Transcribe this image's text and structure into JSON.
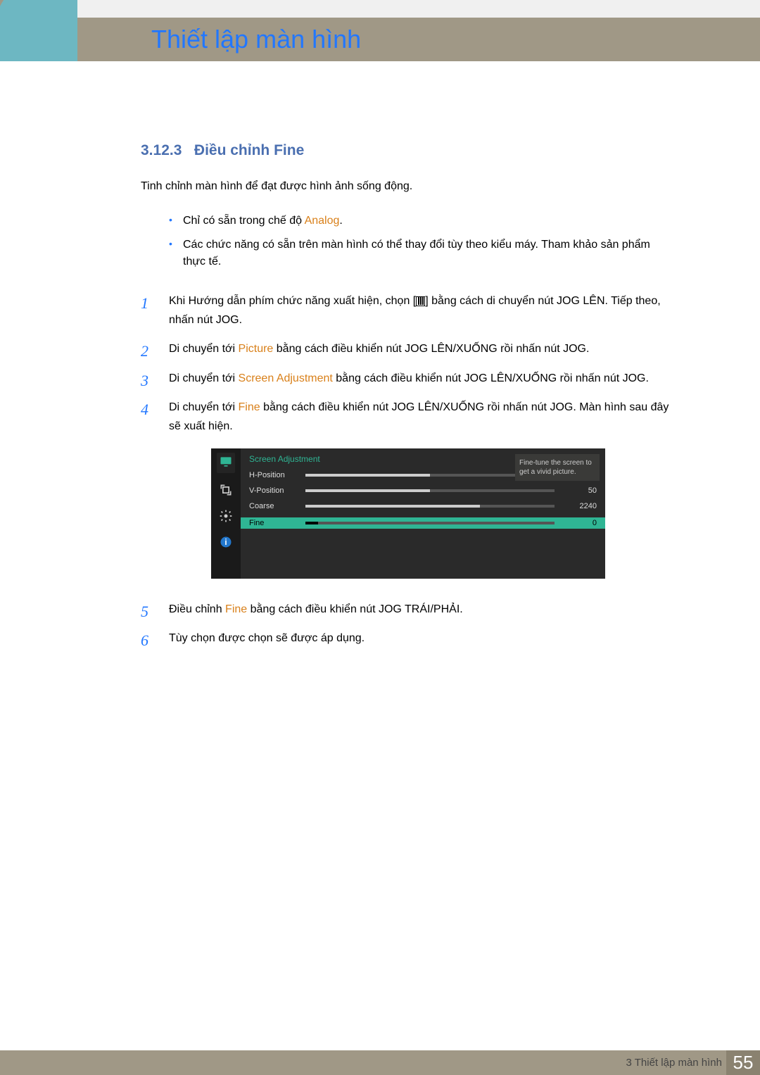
{
  "chapter_title": "Thiết lập màn hình",
  "section": {
    "number": "3.12.3",
    "title": "Điều chỉnh Fine"
  },
  "intro": "Tinh chỉnh màn hình để đạt được hình ảnh sống động.",
  "notes": [
    {
      "pre": "Chỉ có sẵn trong chế độ ",
      "accent": "Analog",
      "post": "."
    },
    {
      "pre": "Các chức năng có sẵn trên màn hình có thể thay đổi tùy theo kiểu máy. Tham khảo sản phẩm thực tế.",
      "accent": "",
      "post": ""
    }
  ],
  "steps": [
    {
      "pre": "Khi Hướng dẫn phím chức năng xuất hiện, chọn [",
      "accent": "",
      "icon": true,
      "post": "] bằng cách di chuyển nút JOG LÊN. Tiếp theo, nhấn nút JOG."
    },
    {
      "pre": "Di chuyển tới ",
      "accent": "Picture",
      "post": " bằng cách điều khiển nút JOG LÊN/XUỐNG rồi nhấn nút JOG."
    },
    {
      "pre": "Di chuyển tới ",
      "accent": "Screen Adjustment",
      "post": " bằng cách điều khiển nút JOG LÊN/XUỐNG rồi nhấn nút JOG."
    },
    {
      "pre": "Di chuyển tới ",
      "accent": "Fine",
      "post": " bằng cách điều khiển nút JOG LÊN/XUỐNG rồi nhấn nút JOG. Màn hình sau đây sẽ xuất hiện."
    },
    {
      "pre": "Điều chỉnh ",
      "accent": "Fine",
      "post": " bằng cách điều khiển nút JOG TRÁI/PHẢI."
    },
    {
      "pre": "Tùy chọn được chọn sẽ được áp dụng.",
      "accent": "",
      "post": ""
    }
  ],
  "osd": {
    "title": "Screen Adjustment",
    "rows": [
      {
        "label": "H-Position",
        "value": "50",
        "pct": 50
      },
      {
        "label": "V-Position",
        "value": "50",
        "pct": 50
      },
      {
        "label": "Coarse",
        "value": "2240",
        "pct": 70
      }
    ],
    "active": {
      "label": "Fine",
      "value": "0",
      "pct": 5
    },
    "tip": "Fine-tune the screen to get a vivid picture."
  },
  "footer": {
    "label": "3 Thiết lập màn hình",
    "page": "55"
  }
}
